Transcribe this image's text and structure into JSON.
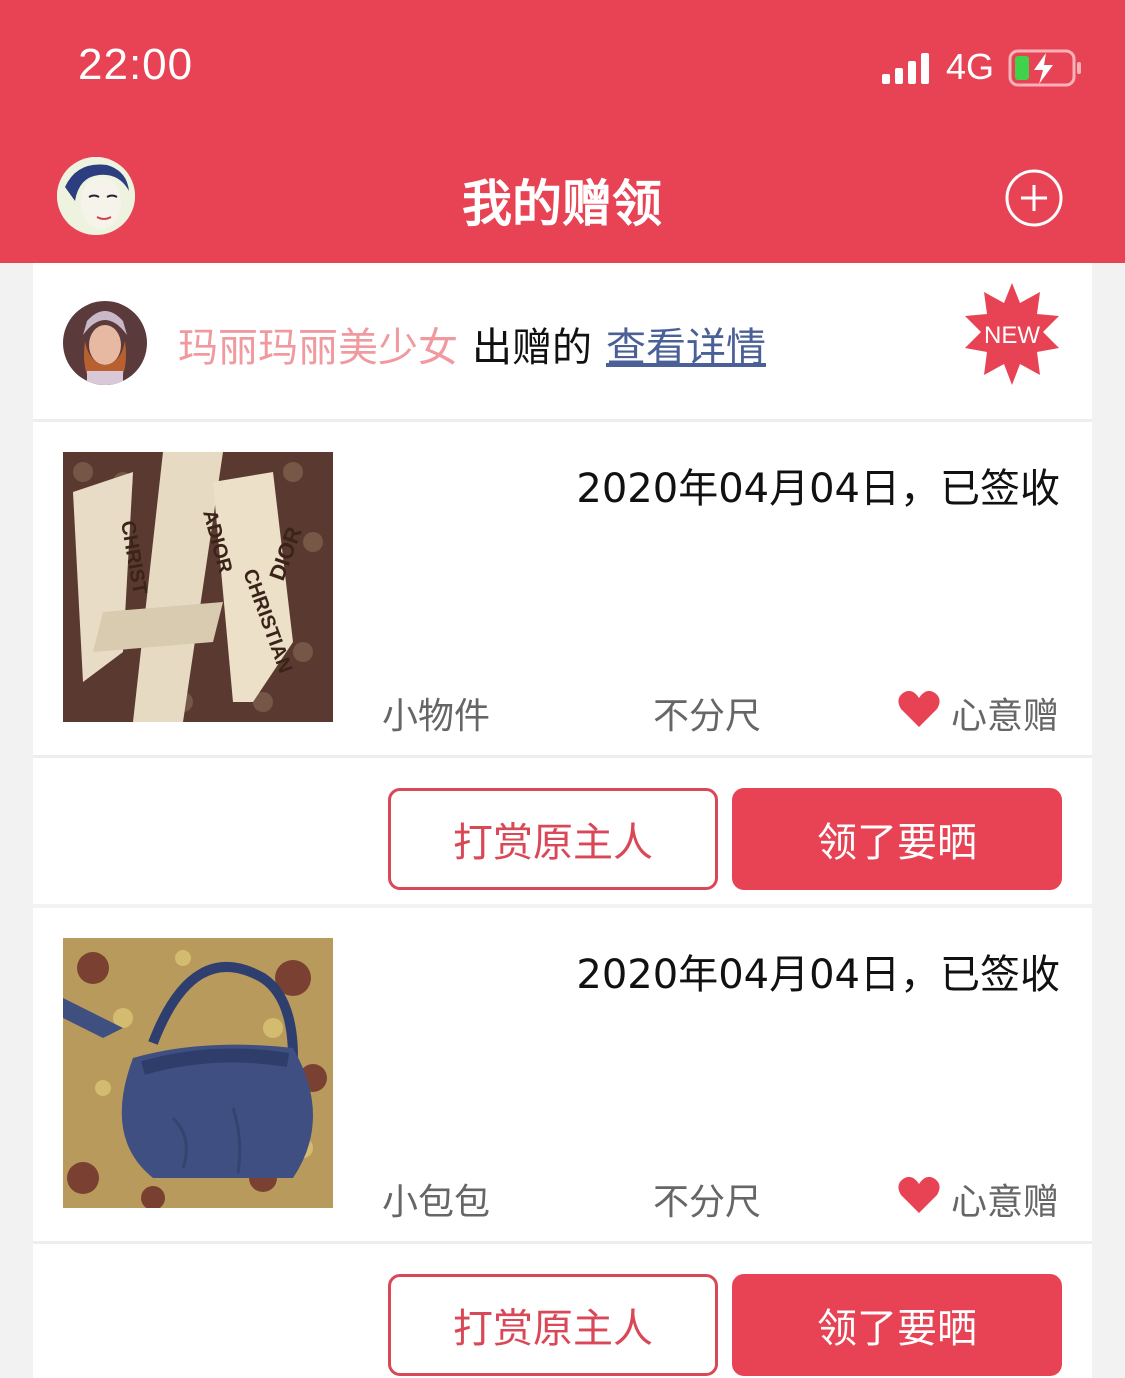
{
  "status_bar": {
    "time": "22:00",
    "network": "4G"
  },
  "header": {
    "title": "我的赠领"
  },
  "owner": {
    "name": "玛丽玛丽美少女",
    "gift_text": "出赠的",
    "detail_link": "查看详情",
    "badge": "NEW"
  },
  "items": [
    {
      "date_status": "2020年04月04日，已签收",
      "category": "小物件",
      "size": "不分尺",
      "gift_type": "心意赠",
      "reward_button": "打赏原主人",
      "share_button": "领了要晒"
    },
    {
      "date_status": "2020年04月04日，已签收",
      "category": "小包包",
      "size": "不分尺",
      "gift_type": "心意赠",
      "reward_button": "打赏原主人",
      "share_button": "领了要晒"
    }
  ],
  "colors": {
    "brand_red": "#e84354",
    "owner_name_pink": "#f09aa0",
    "link_blue": "#4a6096"
  }
}
